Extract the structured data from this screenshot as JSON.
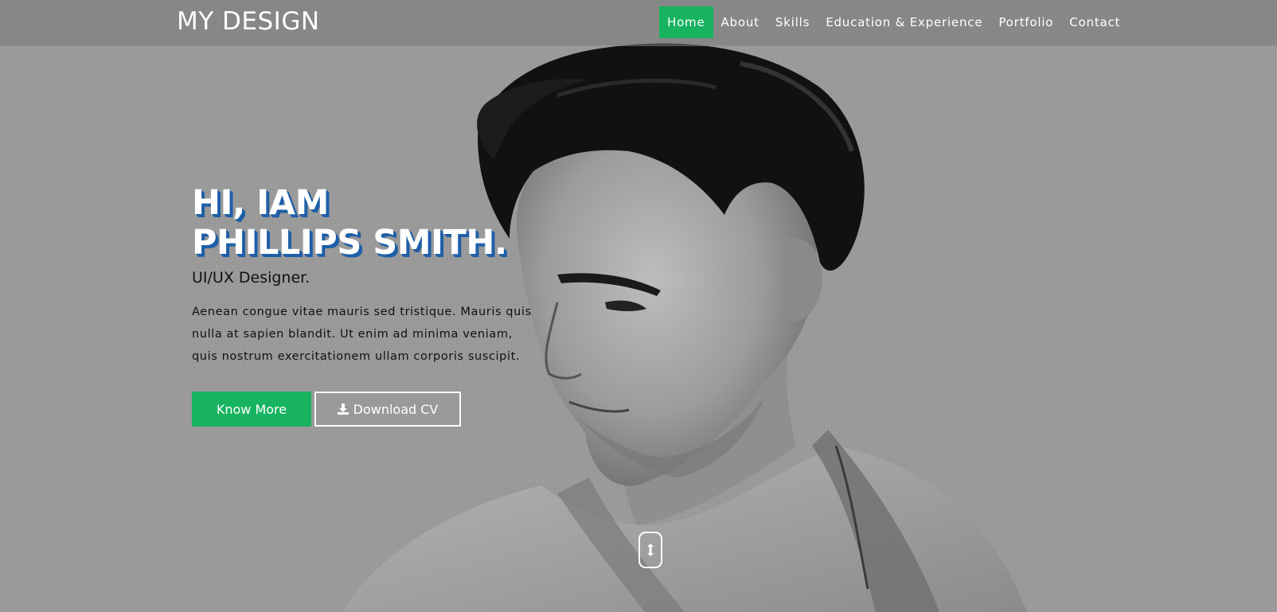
{
  "brand": "MY DESIGN",
  "nav": {
    "items": [
      {
        "label": "Home",
        "active": true
      },
      {
        "label": "About",
        "active": false
      },
      {
        "label": "Skills",
        "active": false
      },
      {
        "label": "Education & Experience",
        "active": false
      },
      {
        "label": "Portfolio",
        "active": false
      },
      {
        "label": "Contact",
        "active": false
      }
    ]
  },
  "hero": {
    "title_line1": "HI, IAM",
    "title_line2": "PHILLIPS SMITH.",
    "subtitle": "UI/UX Designer.",
    "description": "Aenean congue vitae mauris sed tristique. Mauris quis nulla at sapien blandit. Ut enim ad minima veniam, quis nostrum exercitationem ullam corporis suscipit.",
    "primary_button": "Know More",
    "secondary_button": "Download CV",
    "secondary_button_icon": "download-icon",
    "scroll_icon": "scroll-down-icon"
  },
  "colors": {
    "accent": "#17b360",
    "title_shadow": "#1f5fa8",
    "background": "#9a9a9a"
  }
}
